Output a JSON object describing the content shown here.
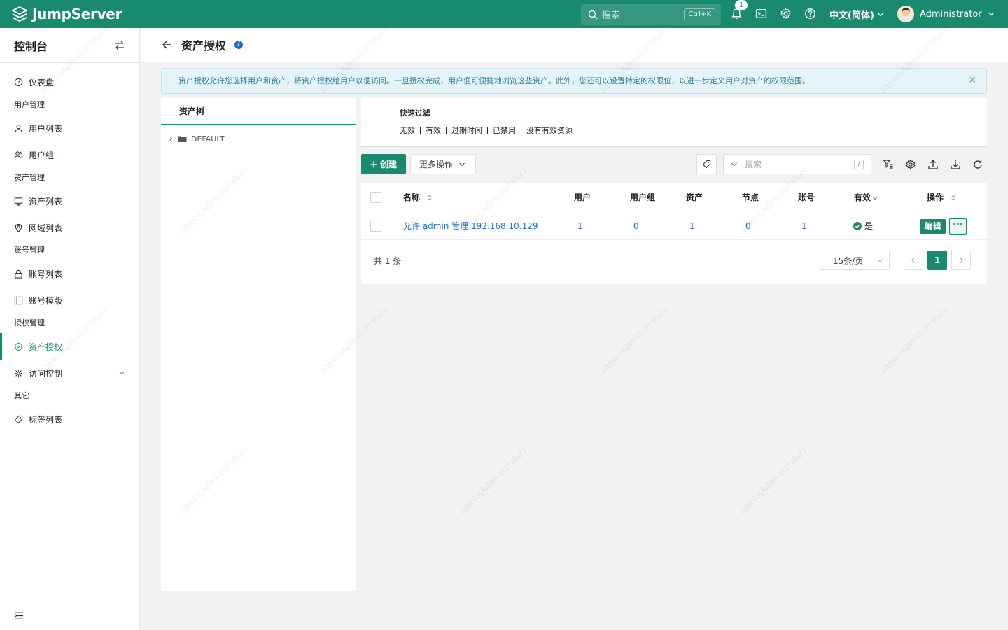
{
  "app": {
    "brand": "JumpServer"
  },
  "topbar": {
    "search_placeholder": "搜索",
    "search_shortcut": "Ctrl+K",
    "notification_count": "1",
    "language": "中文(简体)",
    "username": "Administrator",
    "icons": [
      "bell-icon",
      "terminal-icon",
      "gear-icon",
      "help-icon"
    ]
  },
  "sidebar": {
    "title": "控制台",
    "dashboard": "仪表盘",
    "groups": {
      "user_mgmt": "用户管理",
      "asset_mgmt": "资产管理",
      "account_mgmt": "账号管理",
      "perm_mgmt": "授权管理",
      "other": "其它"
    },
    "items": {
      "user_list": "用户列表",
      "user_group": "用户组",
      "asset_list": "资产列表",
      "domain_list": "网域列表",
      "account_list": "账号列表",
      "account_template": "账号模版",
      "asset_perm": "资产授权",
      "access_control": "访问控制",
      "label_list": "标签列表"
    },
    "active": "资产授权"
  },
  "page": {
    "title": "资产授权",
    "alert": "资产授权允许您选择用户和资产，将资产授权给用户以便访问。一旦授权完成，用户便可便捷地浏览这些资产。此外，您还可以设置特定的权限位，以进一步定义用户对资产的权限范围。"
  },
  "tree": {
    "tab": "资产树",
    "root_node": "DEFAULT"
  },
  "quick_filter": {
    "title": "快速过滤",
    "options": [
      "无效",
      "有效",
      "过期时间",
      "已禁用",
      "没有有效资源"
    ]
  },
  "toolbar": {
    "create_label": "创建",
    "more_label": "更多操作",
    "search_placeholder": "搜索",
    "search_shortcut": "/"
  },
  "table": {
    "headers": {
      "name": "名称",
      "users": "用户",
      "user_groups": "用户组",
      "assets": "资产",
      "nodes": "节点",
      "accounts": "账号",
      "valid": "有效",
      "actions": "操作"
    },
    "rows": [
      {
        "name": "允许 admin 管理 192.168.10.129",
        "users": "1",
        "user_groups": "0",
        "assets": "1",
        "nodes": "0",
        "accounts": "1",
        "valid": "是",
        "edit_label": "编辑",
        "more_label": "···"
      }
    ]
  },
  "pagination": {
    "total": "共 1 条",
    "page_size": "15条/页",
    "current_page": "1"
  },
  "watermark": "admin(Administrator)",
  "colors": {
    "primary": "#1a8a6e",
    "link": "#1c6fd1",
    "alert_bg": "#e6f4f9"
  }
}
